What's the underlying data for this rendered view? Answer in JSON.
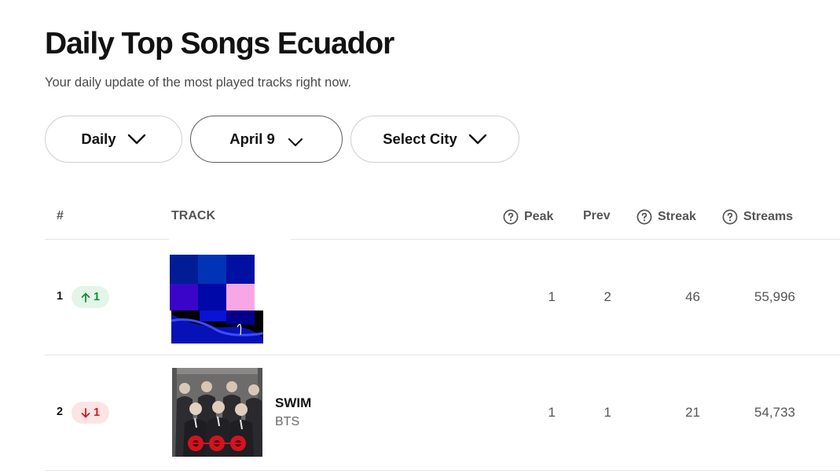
{
  "header": {
    "title": "Daily Top Songs Ecuador",
    "subtitle": "Your daily update of the most played tracks right now."
  },
  "filters": {
    "period": "Daily",
    "date": "April 9",
    "city": "Select City"
  },
  "table": {
    "columns": {
      "rank": "#",
      "track": "TRACK",
      "peak": "Peak",
      "prev": "Prev",
      "streak": "Streak",
      "streams": "Streams"
    },
    "rows": [
      {
        "rank": "1",
        "change": "1",
        "change_direction": "up",
        "title": "",
        "artist": "",
        "peak": "1",
        "prev": "2",
        "streak": "46",
        "streams": "55,996"
      },
      {
        "rank": "2",
        "change": "1",
        "change_direction": "down",
        "title": "SWIM",
        "artist": "BTS",
        "peak": "1",
        "prev": "1",
        "streak": "21",
        "streams": "54,733"
      }
    ]
  },
  "colors": {
    "up_badge_text": "#1a8a3a",
    "up_badge_bg": "#e3f5e8",
    "down_badge_text": "#c32028",
    "down_badge_bg": "#fbe4e4"
  },
  "icons": [
    "chevron-down-icon",
    "help-circle-icon",
    "arrow-up-icon",
    "arrow-down-icon"
  ]
}
